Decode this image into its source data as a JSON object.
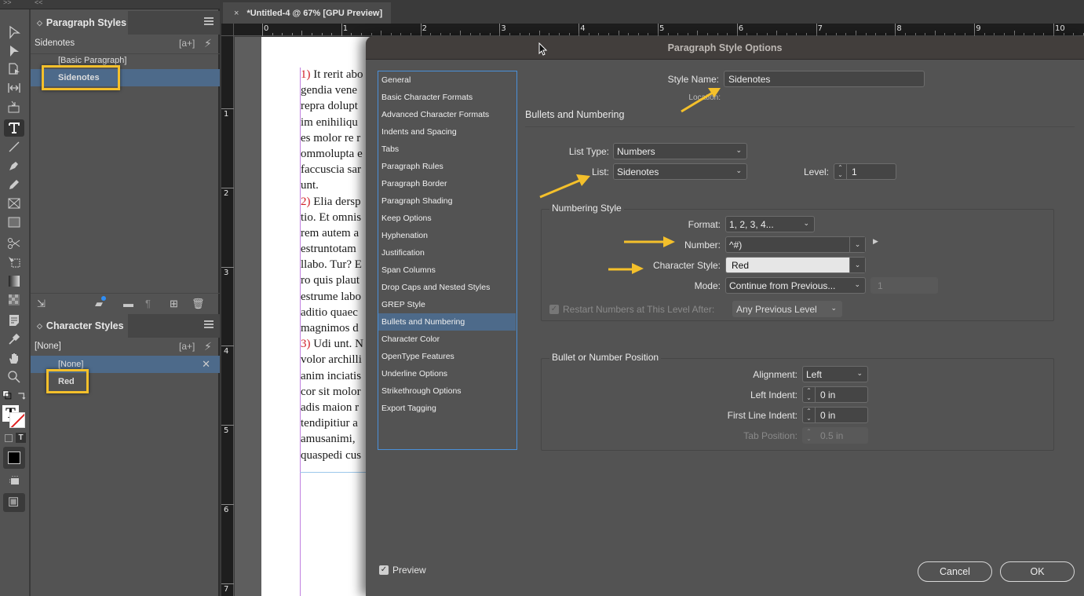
{
  "top_strip": {
    "left_chevrons": ">>",
    "right_chevrons": "<<"
  },
  "document_tab": {
    "close": "×",
    "title": "*Untitled-4 @ 67% [GPU Preview]"
  },
  "rulers": {
    "horizontal": [
      "0",
      "1",
      "2",
      "3",
      "4",
      "5",
      "6",
      "7",
      "8",
      "9",
      "10"
    ],
    "vertical": [
      "1",
      "2",
      "3",
      "4",
      "5",
      "6",
      "7"
    ]
  },
  "toolbar": {
    "tools": [
      {
        "name": "selection-tool-icon"
      },
      {
        "name": "direct-selection-tool-icon"
      },
      {
        "name": "page-tool-icon"
      },
      {
        "name": "gap-tool-icon"
      },
      {
        "name": "content-collector-tool-icon"
      },
      {
        "name": "type-tool-icon",
        "active": true
      },
      {
        "name": "line-tool-icon"
      },
      {
        "name": "pen-tool-icon"
      },
      {
        "name": "pencil-tool-icon"
      },
      {
        "name": "rectangle-frame-tool-icon"
      },
      {
        "name": "rectangle-tool-icon"
      },
      {
        "name": "scissors-tool-icon"
      },
      {
        "name": "free-transform-tool-icon"
      },
      {
        "name": "gradient-swatch-tool-icon"
      },
      {
        "name": "gradient-feather-tool-icon"
      },
      {
        "name": "note-tool-icon"
      },
      {
        "name": "eyedropper-tool-icon"
      },
      {
        "name": "hand-tool-icon"
      },
      {
        "name": "zoom-tool-icon"
      }
    ]
  },
  "paragraph_styles": {
    "tab_label": "Paragraph Styles",
    "current_style": "Sidenotes",
    "new_group_icon": "[a+]",
    "items": [
      {
        "label": "[Basic Paragraph]",
        "selected": false
      },
      {
        "label": "Sidenotes",
        "selected": true
      }
    ]
  },
  "character_styles": {
    "tab_label": "Character Styles",
    "current_style": "[None]",
    "new_group_icon": "[a+]",
    "items": [
      {
        "label": "[None]",
        "selected": true
      },
      {
        "label": "Red",
        "selected": false
      }
    ]
  },
  "document_text": {
    "lines": [
      {
        "num": "1)",
        "text": " It rerit abo"
      },
      {
        "text": "gendia vene"
      },
      {
        "text": "repra dolupt"
      },
      {
        "text": "im enihiliqu"
      },
      {
        "text": "es molor re r"
      },
      {
        "text": "ommolupta e"
      },
      {
        "text": "faccuscia sar"
      },
      {
        "text": "unt."
      },
      {
        "num": "2)",
        "text": " Elia dersp"
      },
      {
        "text": "tio. Et omnis"
      },
      {
        "text": "rem autem a"
      },
      {
        "text": "estruntotam"
      },
      {
        "text": "llabo. Tur? E"
      },
      {
        "text": "ro quis plaut"
      },
      {
        "text": "estrume labo"
      },
      {
        "text": "aditio quaec"
      },
      {
        "text": "magnimos d"
      },
      {
        "num": "3)",
        "text": " Udi unt. N"
      },
      {
        "text": "volor archilli"
      },
      {
        "text": "anim inciatis"
      },
      {
        "text": "cor sit molor"
      },
      {
        "text": "adis maion r"
      },
      {
        "text": "tendipitiur a"
      },
      {
        "text": "amusanimi,"
      },
      {
        "text": "quaspedi cus"
      }
    ]
  },
  "dialog": {
    "title": "Paragraph Style Options",
    "categories": [
      {
        "label": "General"
      },
      {
        "label": "Basic Character Formats"
      },
      {
        "label": "Advanced Character Formats"
      },
      {
        "label": "Indents and Spacing"
      },
      {
        "label": "Tabs"
      },
      {
        "label": "Paragraph Rules"
      },
      {
        "label": "Paragraph Border"
      },
      {
        "label": "Paragraph Shading"
      },
      {
        "label": "Keep Options"
      },
      {
        "label": "Hyphenation"
      },
      {
        "label": "Justification"
      },
      {
        "label": "Span Columns"
      },
      {
        "label": "Drop Caps and Nested Styles"
      },
      {
        "label": "GREP Style"
      },
      {
        "label": "Bullets and Numbering",
        "selected": true
      },
      {
        "label": "Character Color"
      },
      {
        "label": "OpenType Features"
      },
      {
        "label": "Underline Options"
      },
      {
        "label": "Strikethrough Options"
      },
      {
        "label": "Export Tagging"
      }
    ],
    "style_name_label": "Style Name:",
    "style_name_value": "Sidenotes",
    "location_label": "Location:",
    "section_title": "Bullets and Numbering",
    "list_type_label": "List Type:",
    "list_type_value": "Numbers",
    "list_label": "List:",
    "list_value": "Sidenotes",
    "level_label": "Level:",
    "level_value": "1",
    "numbering_style": {
      "title": "Numbering Style",
      "format_label": "Format:",
      "format_value": "1, 2, 3, 4...",
      "number_label": "Number:",
      "number_value": "^#)",
      "char_style_label": "Character Style:",
      "char_style_value": "Red",
      "mode_label": "Mode:",
      "mode_value": "Continue from Previous...",
      "mode_start_value": "1",
      "restart_label": "Restart Numbers at This Level After:",
      "restart_checked": true,
      "restart_value": "Any Previous Level"
    },
    "position": {
      "title": "Bullet or Number Position",
      "alignment_label": "Alignment:",
      "alignment_value": "Left",
      "left_indent_label": "Left Indent:",
      "left_indent_value": "0 in",
      "first_line_label": "First Line Indent:",
      "first_line_value": "0 in",
      "tab_position_label": "Tab Position:",
      "tab_position_value": "0.5 in"
    },
    "preview_label": "Preview",
    "preview_checked": true,
    "cancel_label": "Cancel",
    "ok_label": "OK"
  },
  "colors": {
    "highlight": "#f4c02b",
    "selection": "#4d6a8a",
    "list_border": "#4a90d9",
    "number_red": "#d0202a"
  }
}
